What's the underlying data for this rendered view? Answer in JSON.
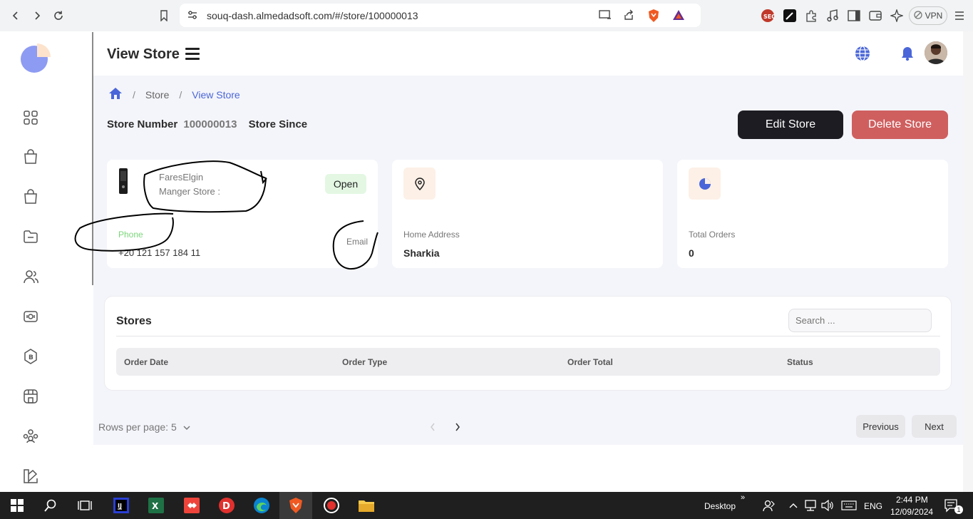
{
  "browser": {
    "url": "souq-dash.almedadsoft.com/#/store/100000013",
    "vpn_label": "VPN"
  },
  "header": {
    "title": "View Store"
  },
  "breadcrumb": {
    "items": [
      "Store",
      "View Store"
    ]
  },
  "store": {
    "number_label": "Store Number",
    "number_value": "100000013",
    "since_label": "Store Since"
  },
  "actions": {
    "edit": "Edit Store",
    "delete": "Delete Store"
  },
  "cards": {
    "owner": {
      "name": "FaresElgin",
      "role": "Manger Store :",
      "status": "Open",
      "phone_label": "Phone",
      "phone_value": "+20 121 157 184 11",
      "email_label": "Email"
    },
    "address": {
      "label": "Home Address",
      "value": "Sharkia"
    },
    "orders": {
      "label": "Total Orders",
      "value": "0"
    }
  },
  "stores_table": {
    "title": "Stores",
    "search_placeholder": "Search ...",
    "columns": [
      "Order Date",
      "Order Type",
      "Order Total",
      "Status"
    ]
  },
  "pagination": {
    "rows_per_page_label": "Rows per page: 5",
    "previous": "Previous",
    "next": "Next"
  },
  "taskbar": {
    "desktop_label": "Desktop",
    "lang": "ENG",
    "time": "2:44 PM",
    "date": "12/09/2024",
    "notification_count": "1"
  },
  "colors": {
    "accent": "#4a66d8",
    "edit_button": "#1c1c22",
    "delete_button": "#cf5f5f",
    "open_badge_bg": "#e3f7e3",
    "phone_label": "#7bd67b"
  }
}
